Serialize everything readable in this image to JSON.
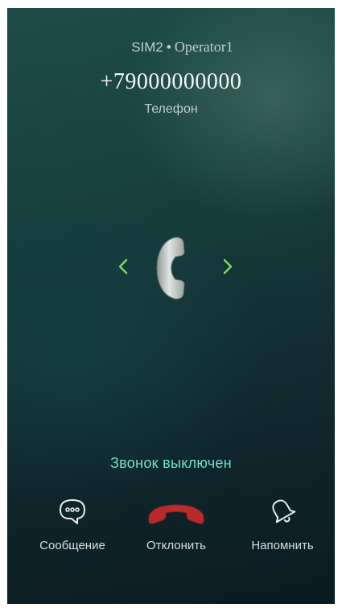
{
  "caller": {
    "sim": "SIM2",
    "separator": "•",
    "operator": "Operator1",
    "number": "+79000000000",
    "label": "Телефон"
  },
  "status_text": "Звонок выключен",
  "actions": [
    {
      "label": "Сообщение",
      "icon": "message-bubble-icon"
    },
    {
      "label": "Отклонить",
      "icon": "hang-up-icon"
    },
    {
      "label": "Напомнить",
      "icon": "bell-icon"
    }
  ],
  "colors": {
    "accent_green": "#7bd96b",
    "status_teal": "#6ee0d0",
    "decline_red": "#b8292a"
  }
}
